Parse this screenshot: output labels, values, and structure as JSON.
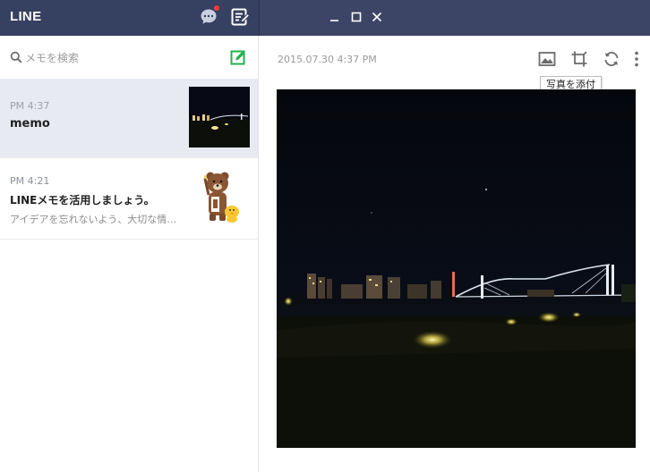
{
  "app": {
    "title": "LINE"
  },
  "colors": {
    "titlebar_left": "#364060",
    "titlebar_right": "#3c4566",
    "selected_row": "#e8eaf2",
    "accent_green": "#22b24c",
    "notification": "#ff3b3b"
  },
  "sidebar": {
    "search": {
      "placeholder": "メモを検索"
    },
    "items": [
      {
        "time": "PM 4:37",
        "title": "memo",
        "preview": "",
        "selected": true,
        "thumbnail": "night-skyline-photo"
      },
      {
        "time": "PM 4:21",
        "title": "LINEメモを活用しましょう。",
        "preview": "アイデアを忘れないよう、大切な情…",
        "selected": false,
        "thumbnail": "brown-bear-sticker"
      }
    ]
  },
  "main": {
    "timestamp": "2015.07.30 4:37 PM",
    "toolbar_icons": [
      "image-icon",
      "crop-icon",
      "refresh-icon",
      "more-icon"
    ],
    "tooltip": "写真を添付"
  }
}
